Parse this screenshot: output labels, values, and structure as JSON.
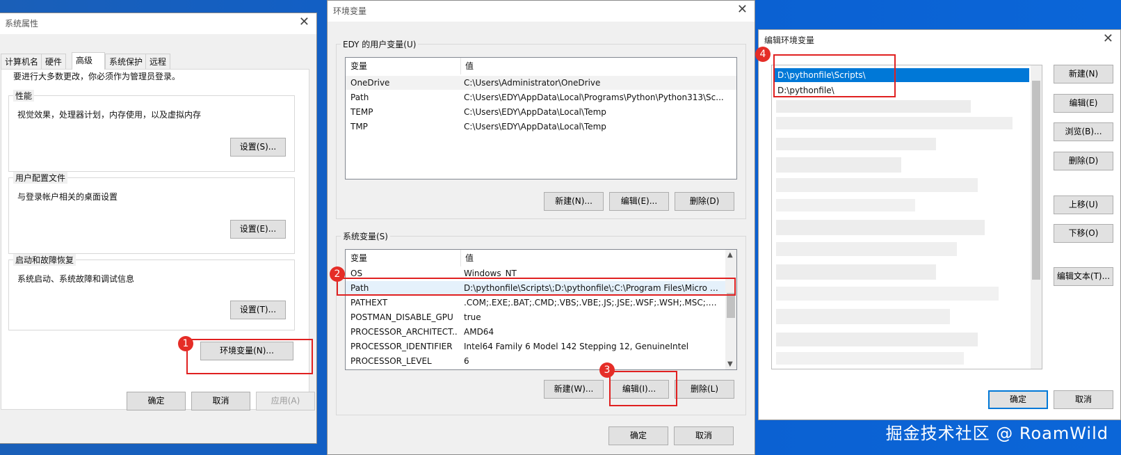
{
  "system_properties": {
    "title": "系统属性",
    "tabs": [
      "计算机名",
      "硬件",
      "高级",
      "系统保护",
      "远程"
    ],
    "admin_note": "要进行大多数更改，你必须作为管理员登录。",
    "performance": {
      "legend": "性能",
      "desc": "视觉效果，处理器计划，内存使用，以及虚拟内存",
      "button": "设置(S)..."
    },
    "user_profile": {
      "legend": "用户配置文件",
      "desc": "与登录帐户相关的桌面设置",
      "button": "设置(E)..."
    },
    "startup": {
      "legend": "启动和故障恢复",
      "desc": "系统启动、系统故障和调试信息",
      "button": "设置(T)..."
    },
    "env_button": "环境变量(N)...",
    "ok": "确定",
    "cancel": "取消",
    "apply": "应用(A)"
  },
  "env_vars": {
    "title": "环境变量",
    "user_group": "EDY 的用户变量(U)",
    "col_var": "变量",
    "col_val": "值",
    "user_rows": [
      {
        "name": "OneDrive",
        "value": "C:\\Users\\Administrator\\OneDrive"
      },
      {
        "name": "Path",
        "value": "C:\\Users\\EDY\\AppData\\Local\\Programs\\Python\\Python313\\Sc..."
      },
      {
        "name": "TEMP",
        "value": "C:\\Users\\EDY\\AppData\\Local\\Temp"
      },
      {
        "name": "TMP",
        "value": "C:\\Users\\EDY\\AppData\\Local\\Temp"
      }
    ],
    "user_new": "新建(N)...",
    "user_edit": "编辑(E)...",
    "user_delete": "删除(D)",
    "system_group": "系统变量(S)",
    "system_rows": [
      {
        "name": "OS",
        "value": "Windows_NT"
      },
      {
        "name": "Path",
        "value": "D:\\pythonfile\\Scripts\\;D:\\pythonfile\\;C:\\Program Files\\Micro F..."
      },
      {
        "name": "PATHEXT",
        "value": ".COM;.EXE;.BAT;.CMD;.VBS;.VBE;.JS;.JSE;.WSF;.WSH;.MSC;.PY;.P..."
      },
      {
        "name": "POSTMAN_DISABLE_GPU",
        "value": "true"
      },
      {
        "name": "PROCESSOR_ARCHITECT...",
        "value": "AMD64"
      },
      {
        "name": "PROCESSOR_IDENTIFIER",
        "value": "Intel64 Family 6 Model 142 Stepping 12, GenuineIntel"
      },
      {
        "name": "PROCESSOR_LEVEL",
        "value": "6"
      }
    ],
    "sys_new": "新建(W)...",
    "sys_edit": "编辑(I)...",
    "sys_delete": "删除(L)",
    "ok": "确定",
    "cancel": "取消"
  },
  "edit_env": {
    "title": "编辑环境变量",
    "entries": [
      "D:\\pythonfile\\Scripts\\",
      "D:\\pythonfile\\"
    ],
    "buttons": {
      "new": "新建(N)",
      "edit": "编辑(E)",
      "browse": "浏览(B)...",
      "delete": "删除(D)",
      "up": "上移(U)",
      "down": "下移(O)",
      "edit_text": "编辑文本(T)..."
    },
    "ok": "确定",
    "cancel": "取消"
  },
  "annotations": {
    "b1": "1",
    "b2": "2",
    "b3": "3",
    "b4": "4"
  },
  "watermark": "掘金技术社区 @ RoamWild",
  "colors": {
    "highlight": "#0078d7",
    "annotation_red": "#e02020",
    "badge_red": "#e52d27"
  }
}
